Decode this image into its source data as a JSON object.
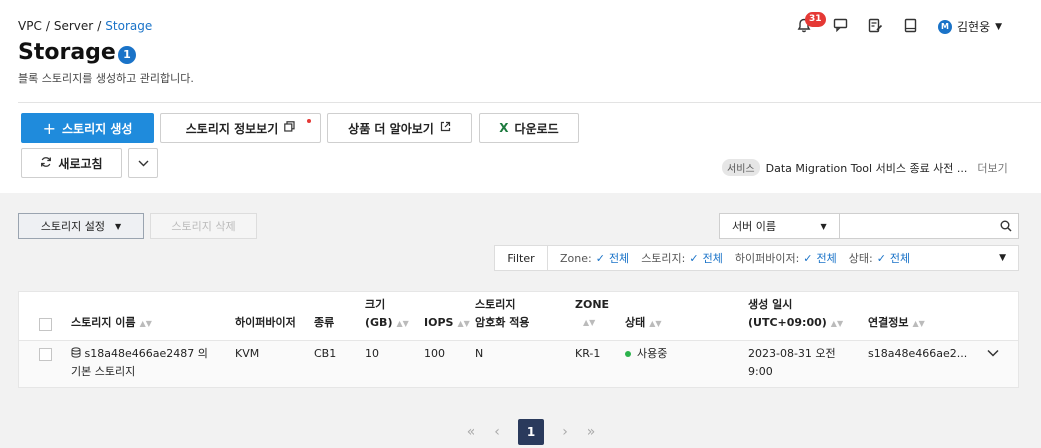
{
  "breadcrumb": {
    "items": [
      "VPC",
      "Server",
      "Storage"
    ],
    "separator": "/"
  },
  "page": {
    "title": "Storage",
    "count": "1",
    "description": "블록 스토리지를 생성하고 관리합니다."
  },
  "header": {
    "notifications_count": "31",
    "user_initial": "M",
    "user_name": "김현웅"
  },
  "toolbar": {
    "create": "스토리지 생성",
    "info": "스토리지 정보보기",
    "learn_more": "상품 더 알아보기",
    "download": "다운로드",
    "refresh": "새로고침"
  },
  "notice": {
    "tag": "서비스",
    "text": "Data Migration Tool 서비스 종료 사전 ...",
    "more": "더보기"
  },
  "actions": {
    "settings": "스토리지 설정",
    "delete": "스토리지 삭제"
  },
  "search": {
    "field": "서버 이름",
    "placeholder": ""
  },
  "filter": {
    "label": "Filter",
    "items": [
      {
        "key": "Zone:",
        "value": "전체"
      },
      {
        "key": "스토리지:",
        "value": "전체"
      },
      {
        "key": "하이퍼바이저:",
        "value": "전체"
      },
      {
        "key": "상태:",
        "value": "전체"
      }
    ]
  },
  "table": {
    "headers": {
      "name": "스토리지 이름",
      "hypervisor": "하이퍼바이저",
      "type": "종류",
      "size_1": "크기",
      "size_2": "(GB)",
      "iops": "IOPS",
      "enc_1": "스토리지",
      "enc_2": "암호화 적용",
      "zone": "ZONE",
      "status": "상태",
      "created_1": "생성 일시",
      "created_2": "(UTC+09:00)",
      "connection": "연결정보"
    },
    "rows": [
      {
        "name_1": "s18a48e466ae2487 의",
        "name_2": "기본 스토리지",
        "hypervisor": "KVM",
        "type": "CB1",
        "size": "10",
        "iops": "100",
        "encryption": "N",
        "zone": "KR-1",
        "status": "사용중",
        "created_1": "2023-08-31 오전",
        "created_2": "9:00",
        "connection": "s18a48e466ae2..."
      }
    ]
  },
  "pagination": {
    "current": "1"
  },
  "colors": {
    "primary": "#1f8bdc",
    "link": "#1a73c8",
    "status_ok": "#2bb24c",
    "badge": "#e53935",
    "page_current": "#2a3a5c"
  }
}
